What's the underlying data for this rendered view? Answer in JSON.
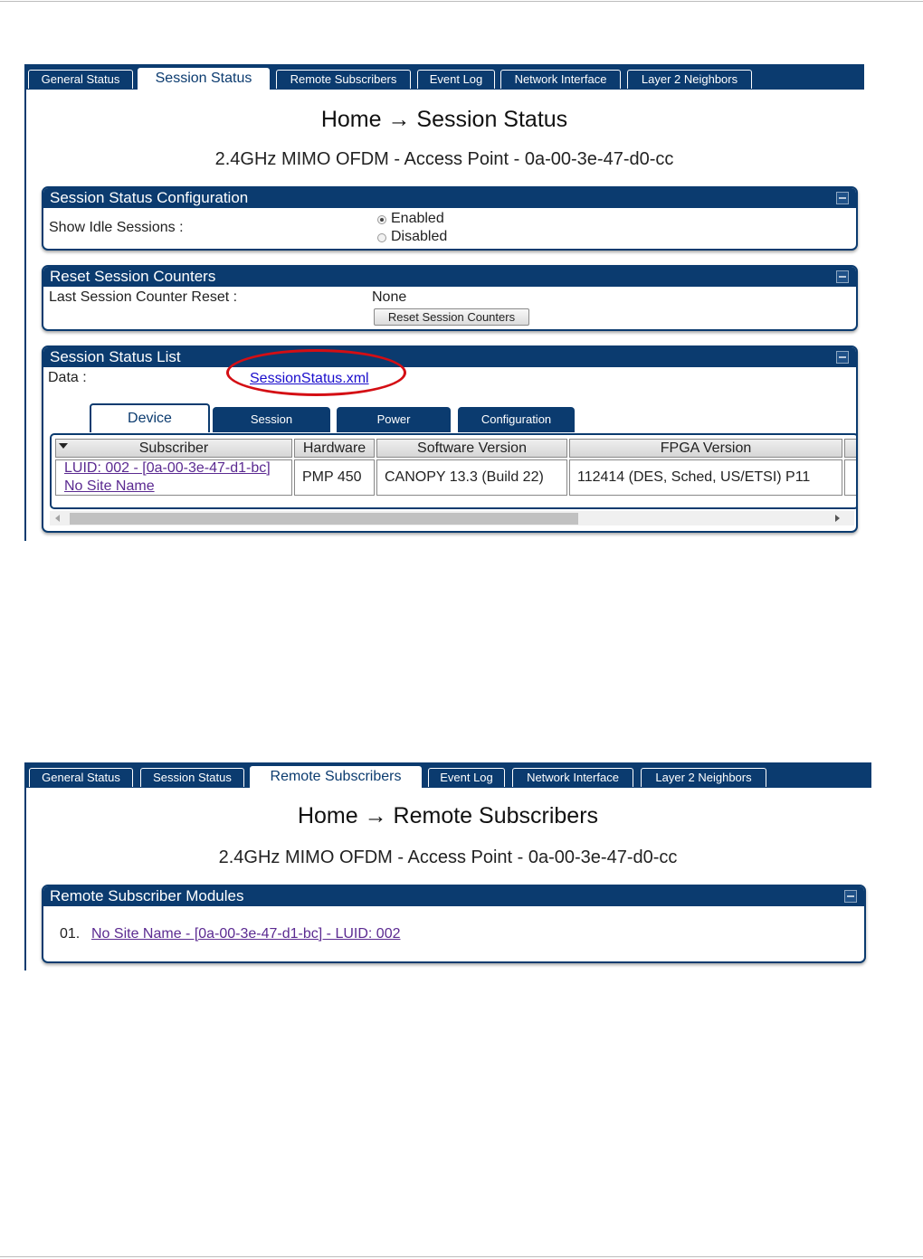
{
  "colors": {
    "navy": "#0b3b6f",
    "link": "#1a0dcc",
    "visited_link": "#5b2a91",
    "highlight": "#d40e14"
  },
  "screenshot1": {
    "tabs": [
      "General Status",
      "Session Status",
      "Remote Subscribers",
      "Event Log",
      "Network Interface",
      "Layer 2 Neighbors"
    ],
    "active_tab": "Session Status",
    "title": "Home → Session Status",
    "subtitle": "2.4GHz MIMO OFDM - Access Point - 0a-00-3e-47-d0-cc",
    "config_panel": {
      "header": "Session Status Configuration",
      "show_idle_label": "Show Idle Sessions :",
      "options": [
        "Enabled",
        "Disabled"
      ],
      "selected": "Enabled"
    },
    "reset_panel": {
      "header": "Reset Session Counters",
      "last_reset_label": "Last Session Counter Reset :",
      "last_reset_value": "None",
      "button": "Reset Session Counters"
    },
    "list_panel": {
      "header": "Session Status List",
      "data_label": "Data :",
      "data_link": "SessionStatus.xml",
      "subtabs": [
        "Device",
        "Session",
        "Power",
        "Configuration"
      ],
      "active_subtab": "Device",
      "columns": [
        "Subscriber",
        "Hardware",
        "Software Version",
        "FPGA Version"
      ],
      "rows": [
        {
          "subscriber_line1": "LUID: 002 - [0a-00-3e-47-d1-bc]",
          "subscriber_line2": "No Site Name",
          "hardware": "PMP 450",
          "software": "CANOPY 13.3 (Build 22)",
          "fpga": "112414 (DES, Sched, US/ETSI) P11"
        }
      ]
    }
  },
  "screenshot2": {
    "tabs": [
      "General Status",
      "Session Status",
      "Remote Subscribers",
      "Event Log",
      "Network Interface",
      "Layer 2 Neighbors"
    ],
    "active_tab": "Remote Subscribers",
    "title": "Home → Remote Subscribers",
    "subtitle": "2.4GHz MIMO OFDM - Access Point - 0a-00-3e-47-d0-cc",
    "modules_panel": {
      "header": "Remote Subscriber Modules",
      "items": [
        {
          "index": "01.",
          "label": "No Site Name - [0a-00-3e-47-d1-bc] - LUID: 002"
        }
      ]
    }
  }
}
